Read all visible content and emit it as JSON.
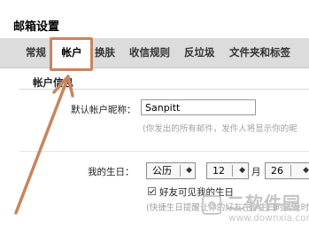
{
  "page": {
    "title": "邮箱设置"
  },
  "tabs": [
    {
      "label": "常规",
      "active": false
    },
    {
      "label": "帐户",
      "active": true
    },
    {
      "label": "换肤",
      "active": false
    },
    {
      "label": "收信规则",
      "active": false
    },
    {
      "label": "反垃圾",
      "active": false
    },
    {
      "label": "文件夹和标签",
      "active": false
    }
  ],
  "section": {
    "title": "帐户信息"
  },
  "nickname": {
    "label": "默认帐户昵称：",
    "value": "Sanpitt",
    "hint": "(你发出的所有邮件，发件人将显示你的昵"
  },
  "birthday": {
    "label": "我的生日：",
    "calendar": "公历",
    "month": "12",
    "month_unit": "月",
    "day": "26",
    "checkbox_label": "好友可见我的生日",
    "checkbox_checked": true,
    "hint": "(快捷生日提醒让你的好友在你生日时能及时"
  },
  "overlay": {
    "highlight_color": "#c8855d",
    "arrow_color": "#c8855d"
  },
  "watermark": {
    "site_name": "二软件园",
    "url": "www.downxia.com"
  }
}
